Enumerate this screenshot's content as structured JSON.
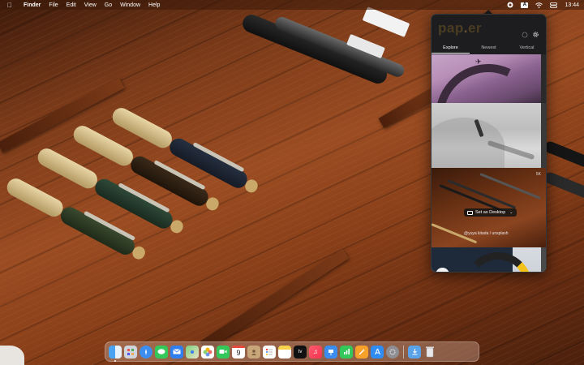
{
  "menubar": {
    "apple_icon": "apple-icon",
    "app_name": "Finder",
    "menus": [
      "File",
      "Edit",
      "View",
      "Go",
      "Window",
      "Help"
    ],
    "status_icons": [
      "paper-status-icon",
      "input-source-icon",
      "wifi-icon",
      "control-center-icon"
    ],
    "input_source_label": "A",
    "clock": "13:44"
  },
  "popover": {
    "logo": "pap",
    "logo_dot": ".",
    "logo_rest": "er",
    "tabs": [
      "Explore",
      "Newest",
      "Vertical"
    ],
    "active_tab": "Explore",
    "wallpapers": [
      {
        "name": "purple-architecture"
      },
      {
        "name": "skateboarder"
      },
      {
        "name": "pens-in-drawer",
        "resolution_badge": "5K",
        "set_button_label": "Set as Desktop",
        "credit": "@yuya kitada / unsplash"
      },
      {
        "name": "jet-engine"
      }
    ]
  },
  "dock": {
    "apps": [
      "Finder",
      "Launchpad",
      "Safari",
      "Messages",
      "Mail",
      "Maps",
      "Photos",
      "FaceTime",
      "Calendar",
      "Contacts",
      "Reminders",
      "Notes",
      "TV",
      "Music",
      "Keynote",
      "Numbers",
      "Pages",
      "App Store",
      "System Preferences"
    ],
    "calendar_day": "9",
    "extras": [
      "Downloads",
      "Trash"
    ]
  },
  "colors": {
    "accent": "#f2c21a",
    "popover_bg": "#1d1d1f"
  }
}
